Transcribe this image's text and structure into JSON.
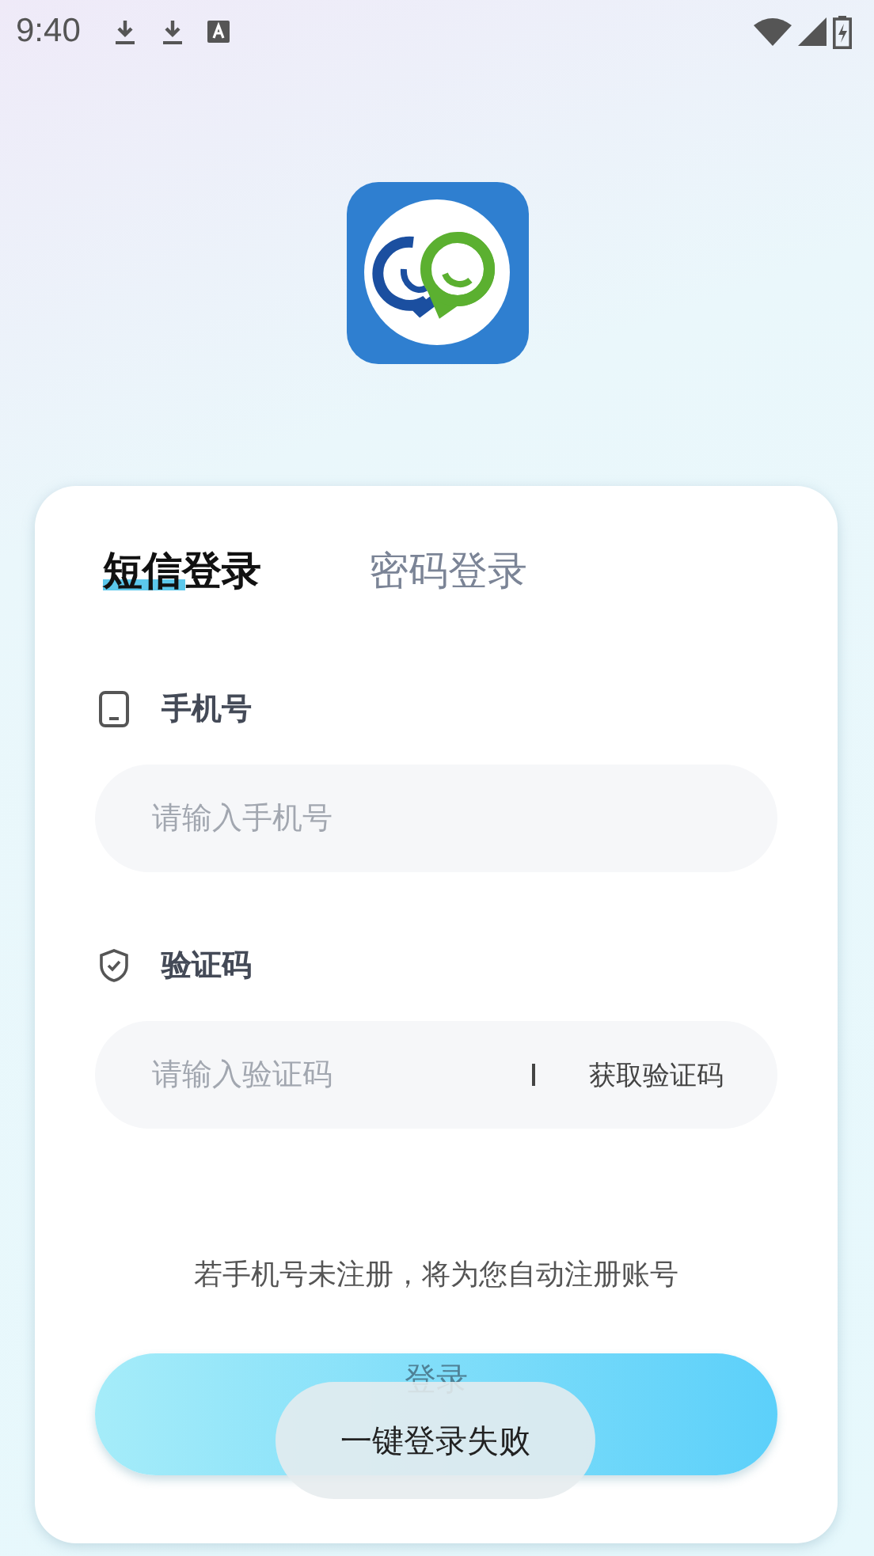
{
  "status_bar": {
    "time": "9:40"
  },
  "tabs": [
    {
      "label": "短信登录",
      "selected": true
    },
    {
      "label": "密码登录",
      "selected": false
    }
  ],
  "fields": [
    {
      "kind": "phone",
      "label": "手机号",
      "placeholder": "请输入手机号"
    },
    {
      "kind": "code",
      "label": "验证码",
      "placeholder": "请输入验证码",
      "action": "获取验证码"
    }
  ],
  "notice": "若手机号未注册，将为您自动注册账号",
  "login_button": {
    "label": "登录"
  },
  "toast": "一键登录失败"
}
